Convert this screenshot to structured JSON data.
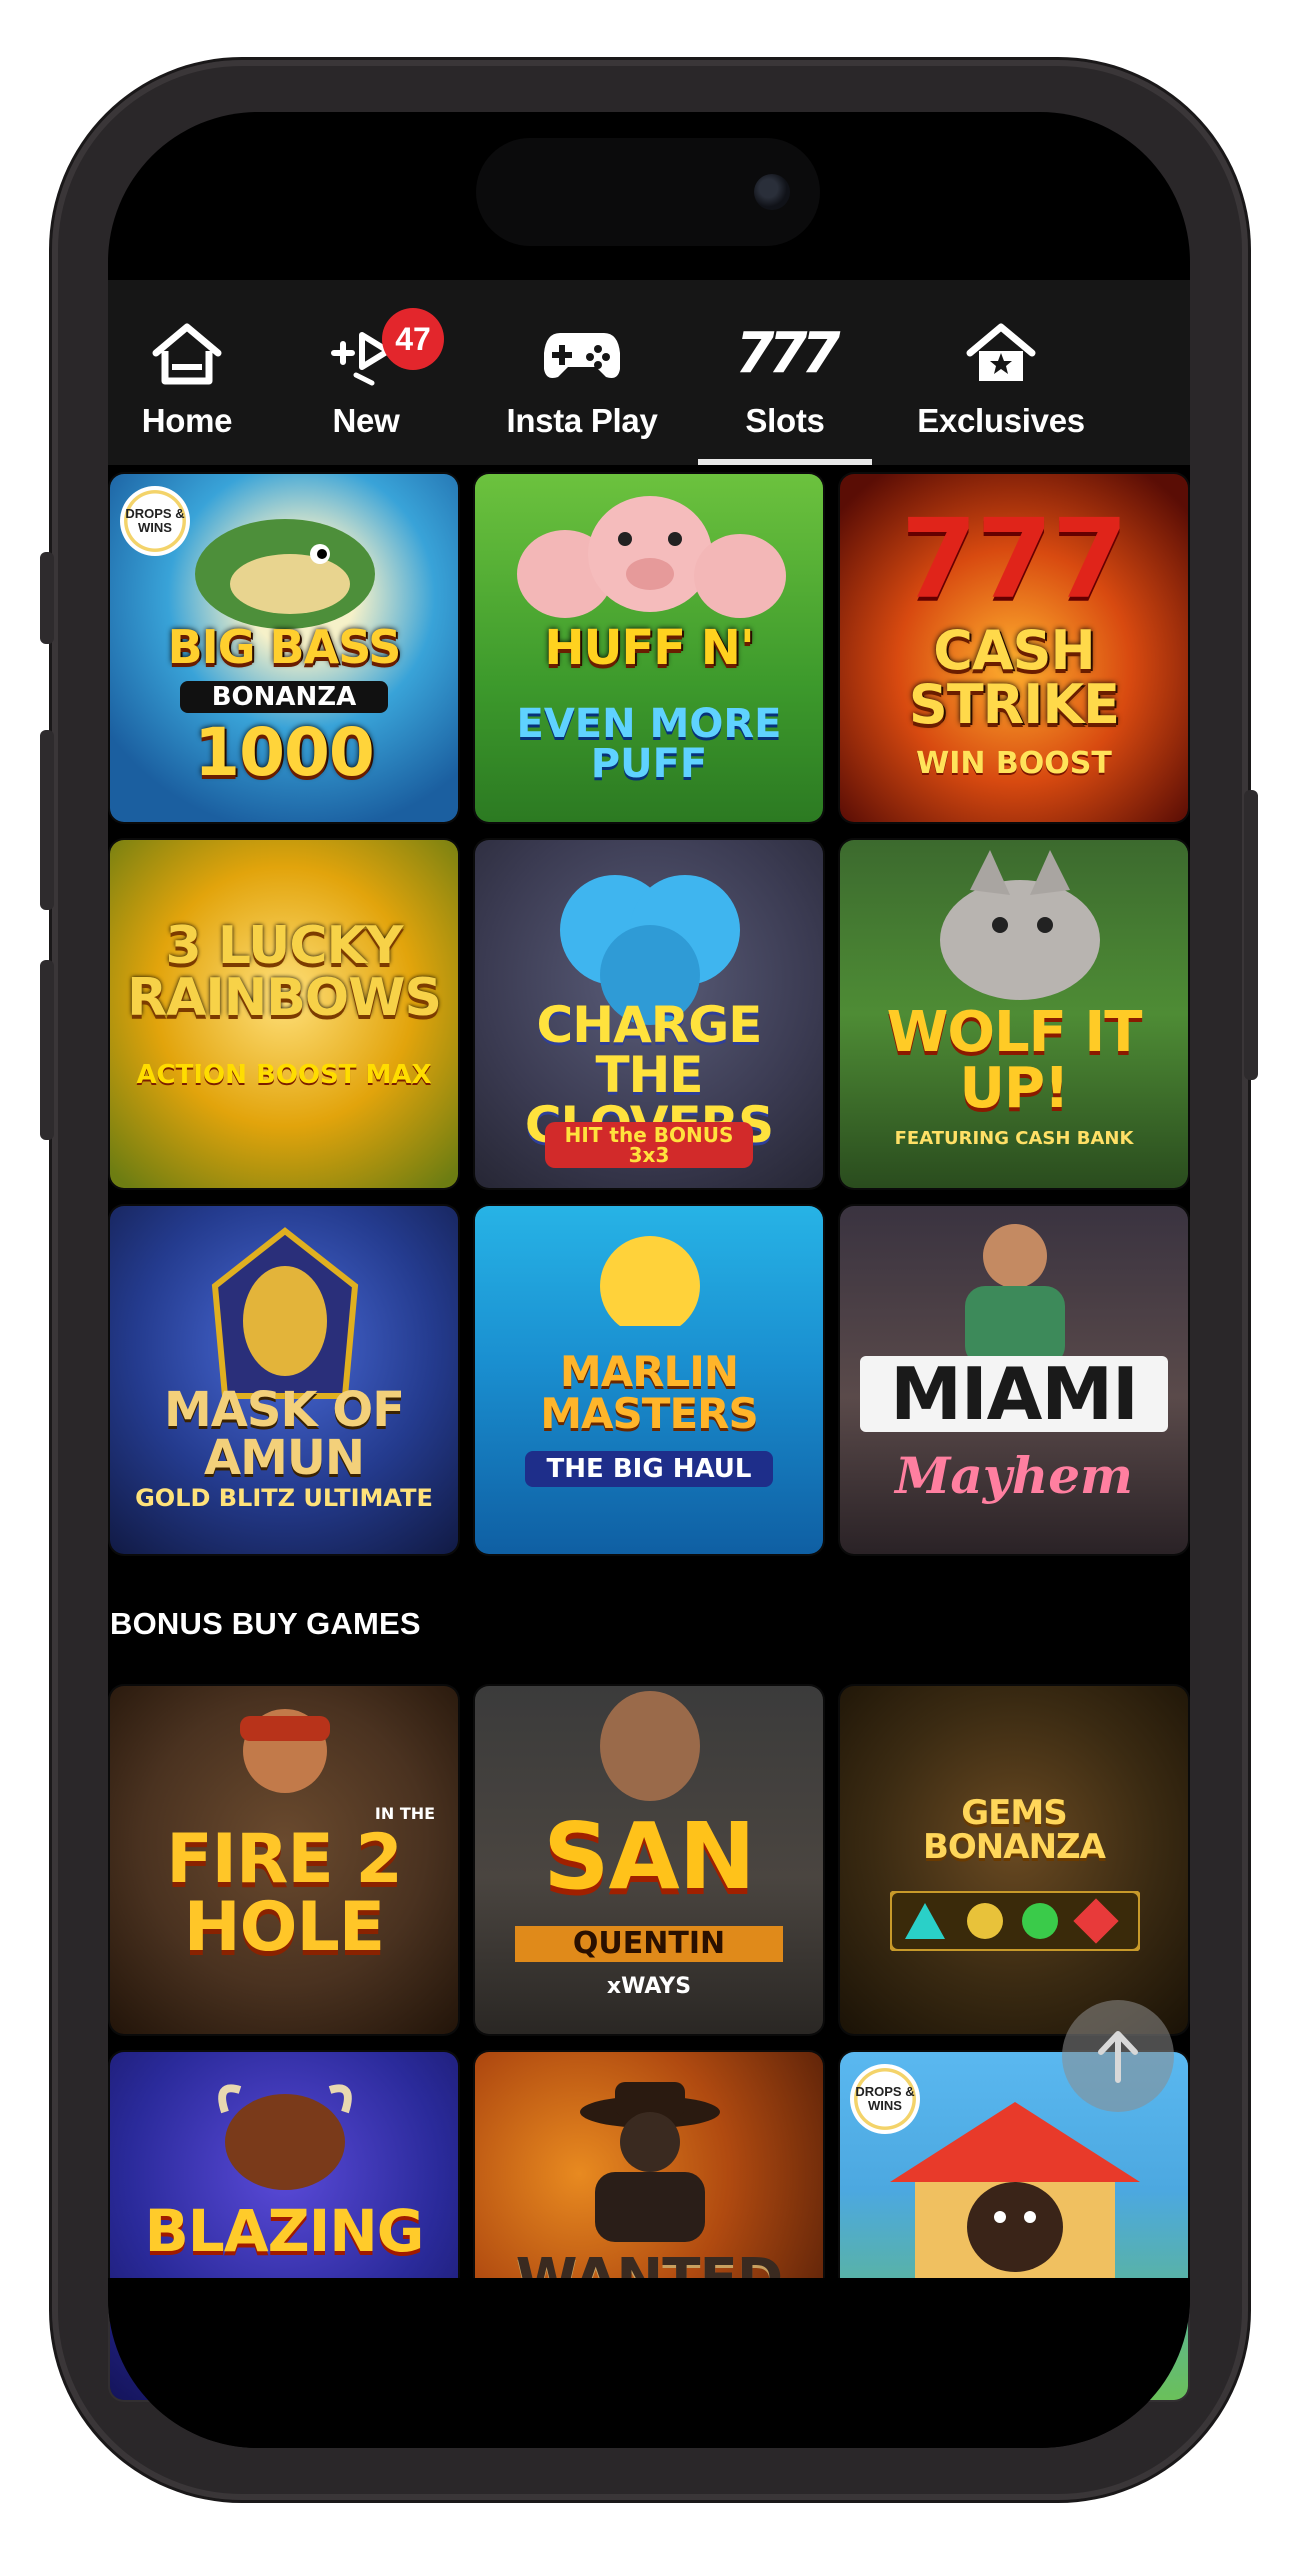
{
  "nav": {
    "items": [
      {
        "label": "Home",
        "icon": "home-icon"
      },
      {
        "label": "New",
        "icon": "new-games-icon",
        "badge": "47"
      },
      {
        "label": "Insta Play",
        "icon": "gamepad-icon"
      },
      {
        "label": "Slots",
        "icon": "slots-777-icon",
        "glyph": "777",
        "active": true
      },
      {
        "label": "Exclusives",
        "icon": "house-star-icon"
      }
    ]
  },
  "games_top": [
    {
      "title": "BIG BASS",
      "subtitle": "BONANZA",
      "extra": "1000",
      "badge": "DROPS & WINS"
    },
    {
      "title": "HUFF N'",
      "subtitle": "EVEN MORE PUFF"
    },
    {
      "title": "CASH STRIKE",
      "subtitle": "WIN BOOST"
    },
    {
      "title": "3 LUCKY RAINBOWS",
      "subtitle": "ACTION BOOST MAX"
    },
    {
      "title": "CHARGE THE CLOVERS",
      "subtitle": "HIT the BONUS 3x3"
    },
    {
      "title": "WOLF IT UP!",
      "subtitle": "FEATURING CASH BANK"
    },
    {
      "title": "MASK OF AMUN",
      "subtitle": "GOLD BLITZ ULTIMATE"
    },
    {
      "title": "MARLIN MASTERS",
      "subtitle": "THE BIG HAUL"
    },
    {
      "title": "MIAMI",
      "subtitle": "Mayhem"
    }
  ],
  "section": {
    "title": "BONUS BUY GAMES"
  },
  "games_bonus": [
    {
      "title": "FIRE 2 HOLE",
      "subtitle": "IN THE"
    },
    {
      "title": "SAN",
      "subtitle": "QUENTIN",
      "extra": "xWAYS"
    },
    {
      "title": "GEMS BONANZA",
      "subtitle": ""
    },
    {
      "title": "BLAZING",
      "subtitle": ""
    },
    {
      "title": "WANTED",
      "subtitle": ""
    },
    {
      "title": "",
      "subtitle": "",
      "badge": "DROPS & WINS"
    }
  ]
}
